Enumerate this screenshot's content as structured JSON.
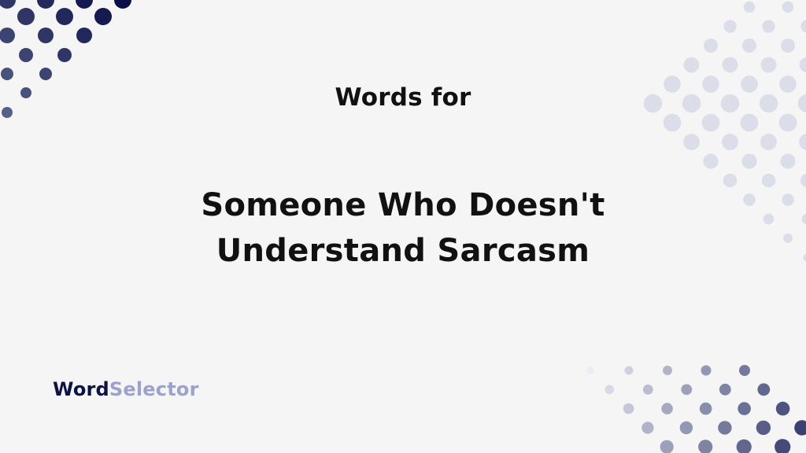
{
  "header": {
    "subtitle": "Words for",
    "title_line1": "Someone Who Doesn't",
    "title_line2": "Understand Sarcasm"
  },
  "brand": {
    "name_part1": "Word",
    "name_part2": "Selector",
    "color_dark": "#0d1340",
    "color_light": "#9da2cb"
  },
  "decor": {
    "dot_dark": "#0a1045",
    "dot_light": "#d9dce8"
  }
}
